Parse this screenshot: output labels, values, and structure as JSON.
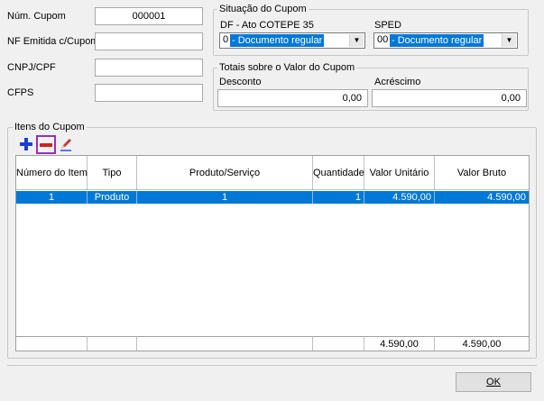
{
  "fields": {
    "num_cupom": {
      "label": "Núm. Cupom",
      "value": "000001"
    },
    "nf_emitida": {
      "label": "NF Emitida c/Cupom",
      "value": ""
    },
    "cnpj_cpf": {
      "label": "CNPJ/CPF",
      "value": ""
    },
    "cfps": {
      "label": "CFPS",
      "value": ""
    }
  },
  "situacao": {
    "title": "Situação do Cupom",
    "df_label": "DF - Ato COTEPE 35",
    "df_code": "0",
    "df_text": " - Documento regular",
    "sped_label": "SPED",
    "sped_code": "00",
    "sped_text": " - Documento regular"
  },
  "totais": {
    "title": "Totais sobre o Valor do Cupom",
    "desconto_label": "Desconto",
    "desconto_value": "0,00",
    "acrescimo_label": "Acréscimo",
    "acrescimo_value": "0,00"
  },
  "itens": {
    "title": "Itens do Cupom",
    "columns": [
      "Número do Item",
      "Tipo",
      "Produto/Serviço",
      "Quantidade",
      "Valor Unitário",
      "Valor Bruto"
    ],
    "rows": [
      [
        "1",
        "Produto",
        "1",
        "1",
        "4.590,00",
        "4.590,00"
      ]
    ],
    "totals": {
      "valor_unitario": "4.590,00",
      "valor_bruto": "4.590,00"
    }
  },
  "toolbar": {
    "add_icon": "plus-icon",
    "remove_icon": "minus-icon",
    "edit_icon": "pencil-icon"
  },
  "ok_label": "OK",
  "colors": {
    "selection": "#0078d7",
    "remove_highlight": "#9b30b0"
  }
}
